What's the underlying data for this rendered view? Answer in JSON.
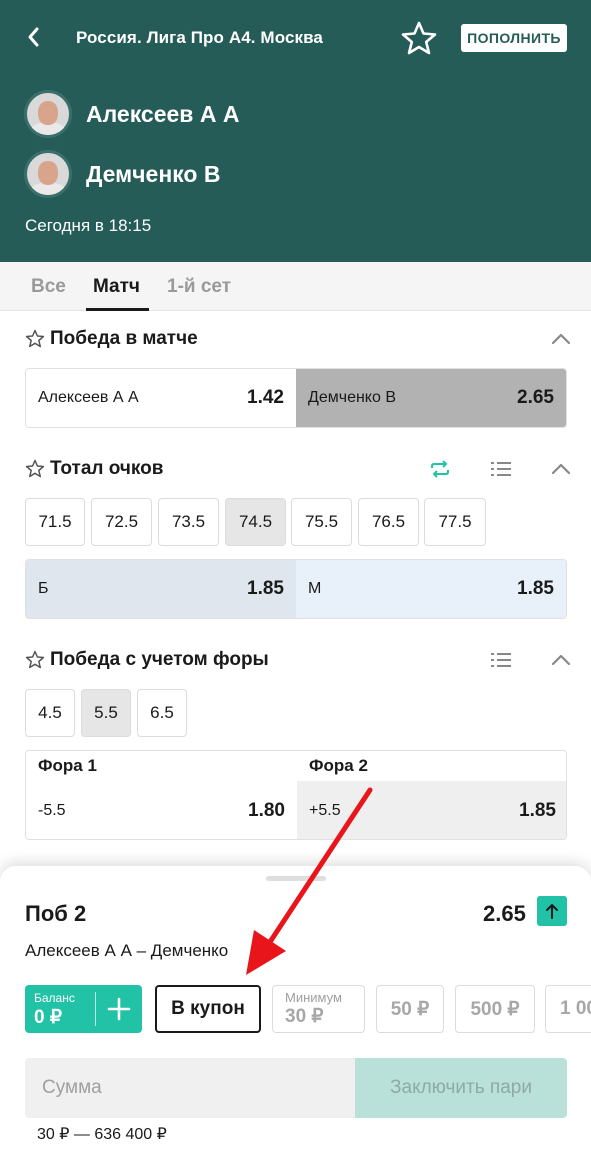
{
  "header": {
    "title": "Россия. Лига Про А4. Москва",
    "topup_label": "ПОПОЛНИТЬ",
    "players": [
      "Алексеев А А",
      "Демченко В"
    ],
    "time": "Сегодня в 18:15"
  },
  "tabs": [
    "Все",
    "Матч",
    "1-й сет"
  ],
  "active_tab": "Матч",
  "win_market": {
    "title": "Победа в матче",
    "p1": {
      "name": "Алексеев А А",
      "odd": "1.42"
    },
    "p2": {
      "name": "Демченко В",
      "odd": "2.65"
    }
  },
  "total_market": {
    "title": "Тотал очков",
    "lines": [
      "71.5",
      "72.5",
      "73.5",
      "74.5",
      "75.5",
      "76.5",
      "77.5"
    ],
    "selected_line": "74.5",
    "over": {
      "label": "Б",
      "odd": "1.85"
    },
    "under": {
      "label": "М",
      "odd": "1.85"
    }
  },
  "handicap_market": {
    "title": "Победа с учетом форы",
    "lines": [
      "4.5",
      "5.5",
      "6.5"
    ],
    "selected_line": "5.5",
    "h1": {
      "header": "Фора 1",
      "line": "-5.5",
      "odd": "1.80"
    },
    "h2": {
      "header": "Фора 2",
      "line": "+5.5",
      "odd": "1.85"
    }
  },
  "bet_slip": {
    "title": "Поб 2",
    "coef": "2.65",
    "match": "Алексеев А А – Демченко",
    "balance_label": "Баланс",
    "balance_amount": "0 ₽",
    "coupon_label": "В купон",
    "min_label": "Минимум",
    "min_amount": "30 ₽",
    "quick_amounts": [
      "50 ₽",
      "500 ₽",
      "1 00"
    ],
    "sum_placeholder": "Сумма",
    "place_bet_label": "Заключить пари",
    "range": "30 ₽ — 636 400 ₽"
  },
  "colors": {
    "header_bg": "#255c57",
    "accent": "#21c2a5",
    "arrow": "#e8161b"
  }
}
